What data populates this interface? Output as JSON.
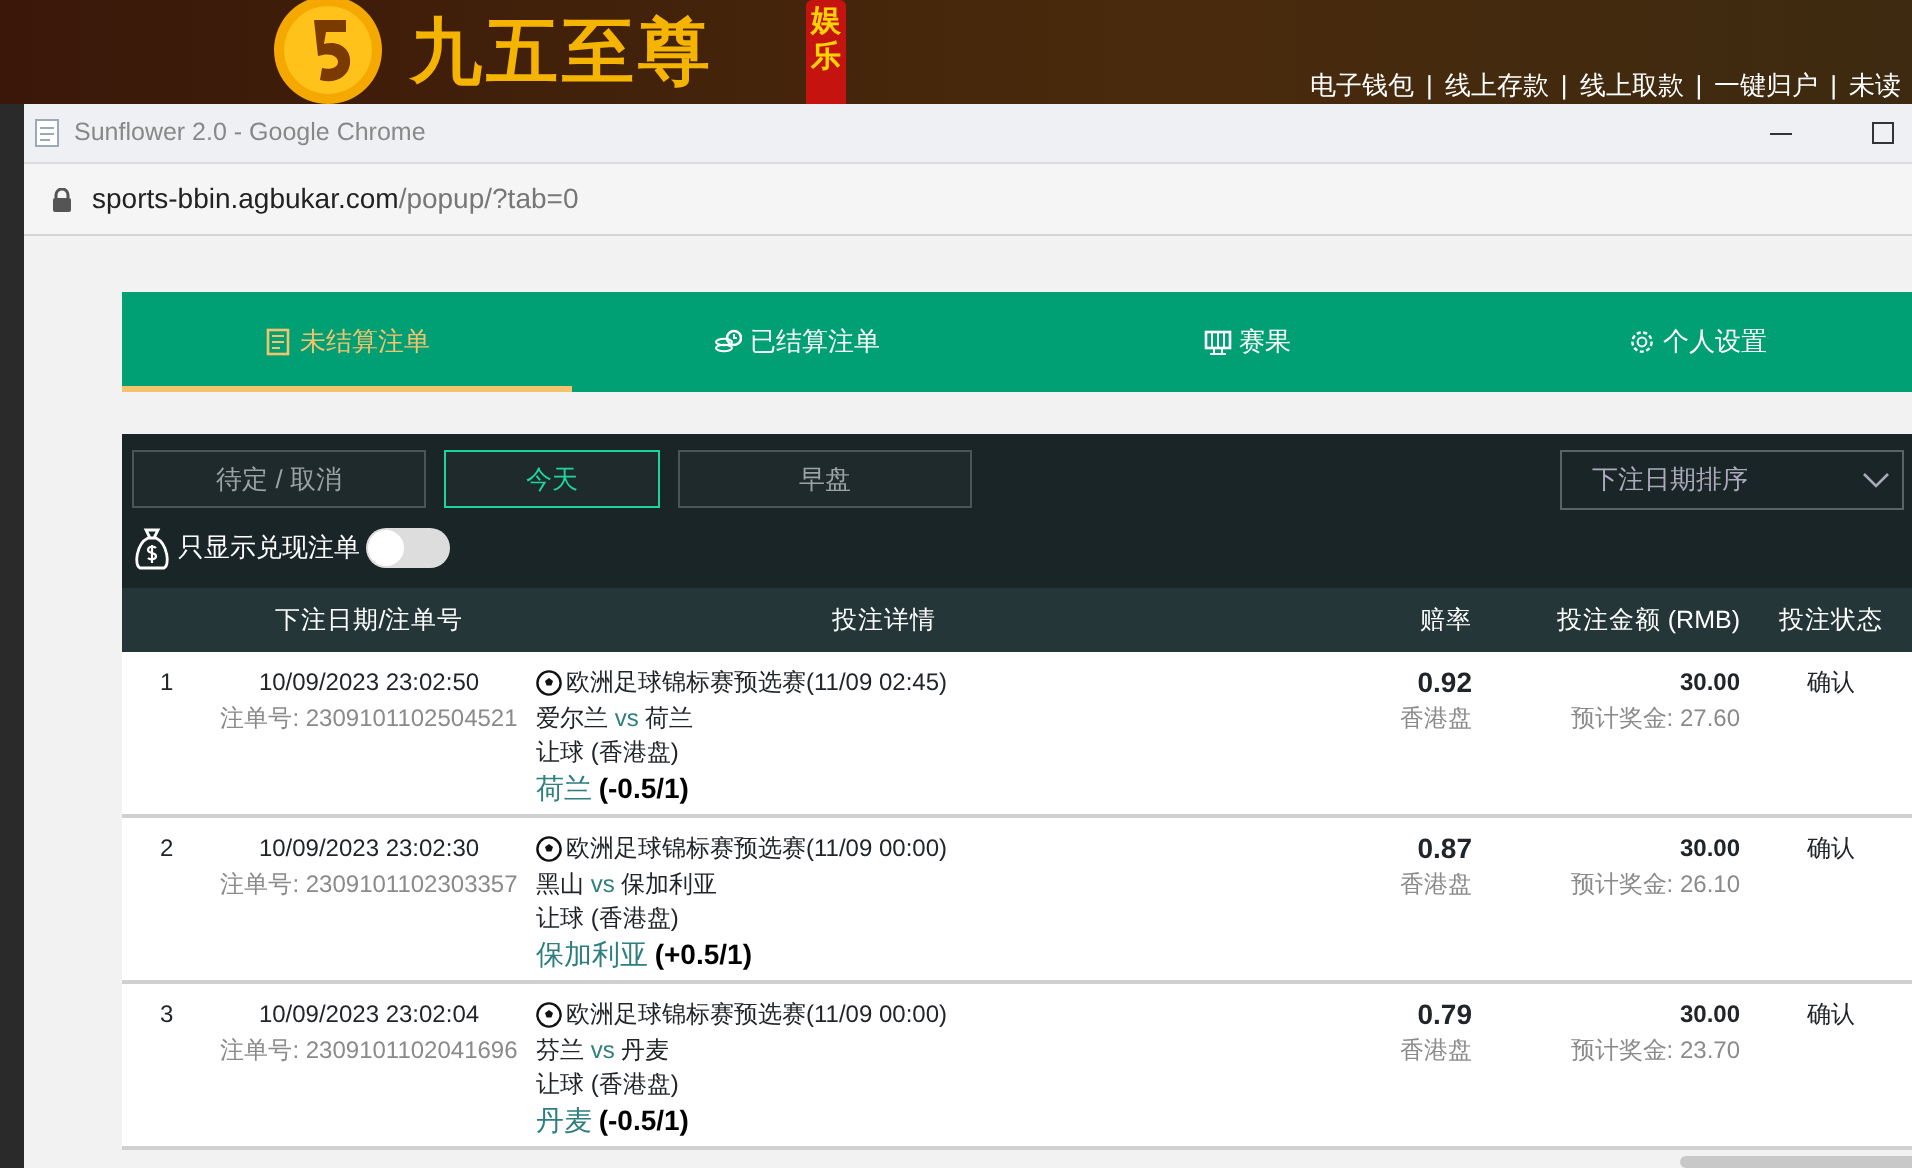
{
  "background_site": {
    "logo_text": "九五至尊",
    "logo_tag": "娱乐",
    "links": [
      {
        "label": "电子钱包"
      },
      {
        "label": "线上存款"
      },
      {
        "label": "线上取款"
      },
      {
        "label": "一键归户"
      },
      {
        "label": "未读"
      }
    ],
    "separator": "|"
  },
  "window": {
    "title": "Sunflower 2.0 - Google Chrome",
    "url_host": "sports-bbin.agbukar.com",
    "url_path": "/popup/?tab=0"
  },
  "tabs": [
    {
      "label": "未结算注单",
      "kind": "list",
      "selected": true
    },
    {
      "label": "已结算注单",
      "kind": "coins",
      "selected": false
    },
    {
      "label": "赛果",
      "kind": "board",
      "selected": false
    },
    {
      "label": "个人设置",
      "kind": "gear",
      "selected": false
    }
  ],
  "filters": [
    {
      "label": "待定 / 取消",
      "selected": false
    },
    {
      "label": "今天",
      "selected": true
    },
    {
      "label": "早盘",
      "selected": false
    }
  ],
  "sort": {
    "value": "下注日期排序"
  },
  "cashout_filter": {
    "label": "只显示兑现注单",
    "on": false
  },
  "table": {
    "columns": {
      "date": "下注日期/注单号",
      "details": "投注详情",
      "odds": "赔率",
      "stake": "投注金额 (RMB)",
      "status": "投注状态"
    },
    "rows": [
      {
        "index": "1",
        "date": "10/09/2023 23:02:50",
        "order": "注单号: 2309101102504521",
        "league": "欧洲足球锦标赛预选赛(11/09 02:45)",
        "home": "爱尔兰",
        "vs": "vs",
        "away": "荷兰",
        "market": "让球 (香港盘)",
        "pick": "荷兰",
        "line": "(-0.5/1)",
        "odds": "0.92",
        "odds_type": "香港盘",
        "stake": "30.00",
        "payout": "预计奖金: 27.60",
        "status": "确认"
      },
      {
        "index": "2",
        "date": "10/09/2023 23:02:30",
        "order": "注单号: 2309101102303357",
        "league": "欧洲足球锦标赛预选赛(11/09 00:00)",
        "home": "黑山",
        "vs": "vs",
        "away": "保加利亚",
        "market": "让球 (香港盘)",
        "pick": "保加利亚",
        "line": "(+0.5/1)",
        "odds": "0.87",
        "odds_type": "香港盘",
        "stake": "30.00",
        "payout": "预计奖金: 26.10",
        "status": "确认"
      },
      {
        "index": "3",
        "date": "10/09/2023 23:02:04",
        "order": "注单号: 2309101102041696",
        "league": "欧洲足球锦标赛预选赛(11/09 00:00)",
        "home": "芬兰",
        "vs": "vs",
        "away": "丹麦",
        "market": "让球 (香港盘)",
        "pick": "丹麦",
        "line": "(-0.5/1)",
        "odds": "0.79",
        "odds_type": "香港盘",
        "stake": "30.00",
        "payout": "预计奖金: 23.70",
        "status": "确认"
      }
    ]
  }
}
